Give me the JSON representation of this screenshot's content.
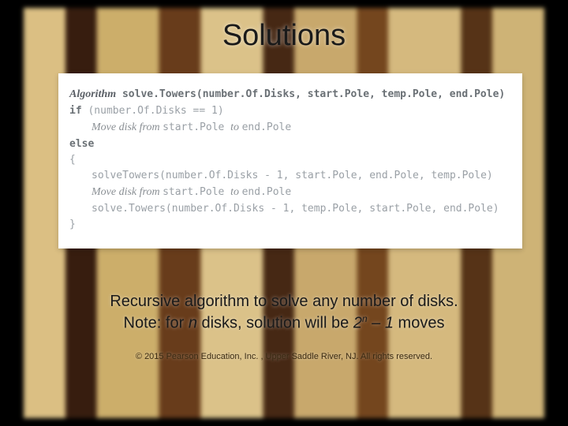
{
  "title": "Solutions",
  "code": {
    "l1_kw": "Algorithm",
    "l1_sig": " solve.Towers(number.Of.Disks, start.Pole, temp.Pole, end.Pole)",
    "l2_kw": "if",
    "l2_rest": " (number.Of.Disks == 1)",
    "l3_a": "Move disk from ",
    "l3_b": "start.Pole ",
    "l3_c": "to ",
    "l3_d": "end.Pole",
    "l4_kw": "else",
    "l5": "{",
    "l6": "solveTowers(number.Of.Disks - 1, start.Pole, end.Pole, temp.Pole)",
    "l7_a": "Move disk from ",
    "l7_b": "start.Pole ",
    "l7_c": "to ",
    "l7_d": "end.Pole",
    "l8": "solve.Towers(number.Of.Disks - 1, temp.Pole, start.Pole, end.Pole)",
    "l9": "}"
  },
  "caption": {
    "line1": "Recursive algorithm to solve any number of disks.",
    "line2_a": "Note: for ",
    "line2_b": "n",
    "line2_c": " disks, solution will be ",
    "line2_d": "2",
    "line2_sup": "n",
    "line2_e": " – 1",
    "line2_f": " moves"
  },
  "footer": "© 2015 Pearson Education, Inc. , Upper Saddle River, NJ.  All rights reserved."
}
